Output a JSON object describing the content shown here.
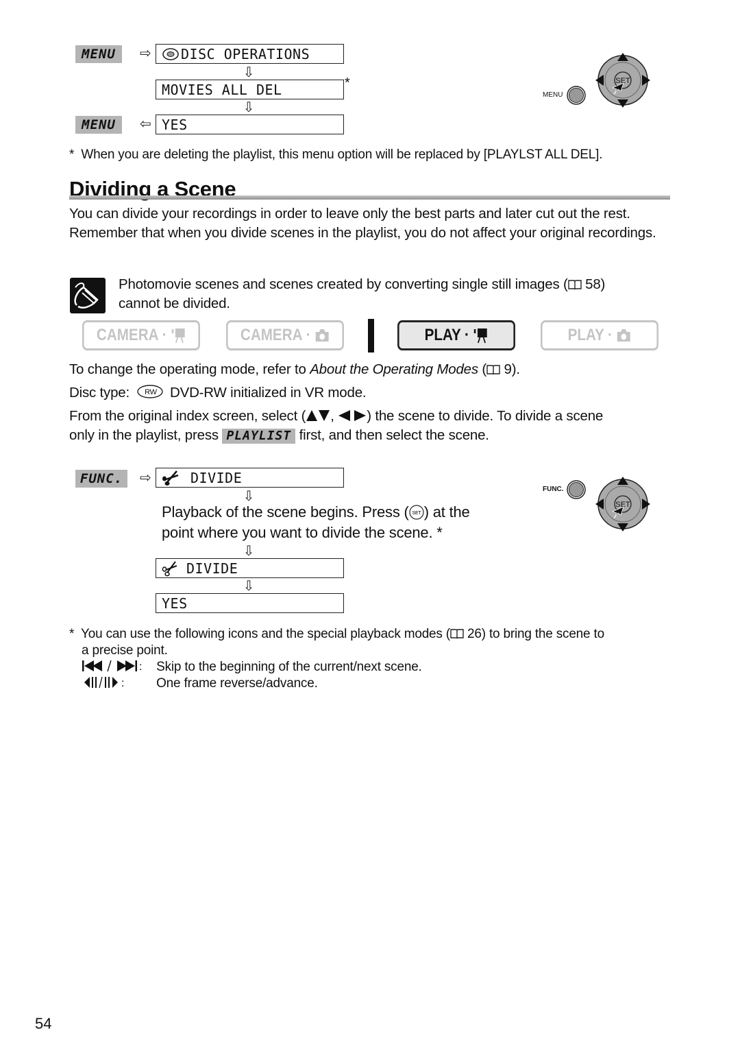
{
  "menu_procedure": {
    "menu_label": "MENU",
    "steps": [
      "DISC OPERATIONS",
      "MOVIES ALL DEL",
      "YES"
    ],
    "asterisk": "*",
    "controls": {
      "menu_button_label": "MENU",
      "set_label": "SET"
    }
  },
  "footnote_top": {
    "mark": "*",
    "text": "When you are deleting the playlist, this menu option will be replaced by [PLAYLST ALL DEL]."
  },
  "section": {
    "title": "Dividing a Scene",
    "intro": "You can divide your recordings in order to leave only the best parts and later cut out the rest. Remember that when you divide scenes in the playlist, you do not affect your original recordings."
  },
  "note": {
    "line1": "Photomovie scenes and scenes created by converting single still images (",
    "page_ref": "58)",
    "line2": "cannot be divided."
  },
  "modes": [
    {
      "label": "CAMERA",
      "icon": "movie-icon",
      "active": false
    },
    {
      "label": "CAMERA",
      "icon": "camera-icon",
      "active": false
    },
    {
      "label": "PLAY",
      "icon": "movie-icon",
      "active": true
    },
    {
      "label": "PLAY",
      "icon": "camera-icon",
      "active": false
    }
  ],
  "instructions": {
    "operating_mode_prefix": "To change the operating mode, refer to ",
    "operating_mode_link": "About the Operating Modes",
    "operating_mode_open": " (",
    "operating_mode_page": "9).",
    "disc_type_label": "Disc type:",
    "disc_type_badge": "RW",
    "disc_type_value": "DVD-RW initialized in VR mode.",
    "select_line1_a": "From the original index screen, select (",
    "select_line1_b": ") the scene to divide. To divide a scene",
    "select_sep": ",",
    "select_line2_a": "only in the playlist, press",
    "playlist_button": "PLAYLIST",
    "select_line2_b": "first, and then select the scene."
  },
  "func_procedure": {
    "func_label": "FUNC.",
    "step1": "DIVIDE",
    "playback_text_1": "Playback of the scene begins. Press (",
    "playback_text_2": ") at the",
    "playback_text_3": "point where you want to divide the scene. *",
    "step2": "DIVIDE",
    "step3": "YES",
    "controls": {
      "func_button_label": "FUNC.",
      "set_label": "SET"
    }
  },
  "footnote_bottom": {
    "mark": "*",
    "line1_a": "You can use the following icons and the special playback modes (",
    "line1_page": "26) to bring the scene to",
    "line2": "a precise point.",
    "items": [
      {
        "icon": "skip-icons",
        "text": "Skip to the beginning of the current/next scene."
      },
      {
        "icon": "frame-icons",
        "text": "One frame reverse/advance."
      }
    ]
  },
  "page_number": "54"
}
